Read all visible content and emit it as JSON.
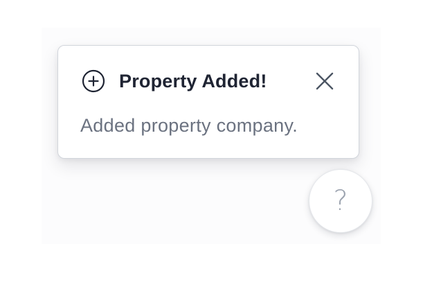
{
  "toast": {
    "icon": "plus-circle-icon",
    "title": "Property Added!",
    "message": "Added property company.",
    "close_icon": "close-icon"
  },
  "help": {
    "icon": "question-icon",
    "glyph": "?"
  },
  "colors": {
    "title": "#1f2433",
    "message": "#6b7280",
    "border": "#d1d5db",
    "help_glyph": "#9ca3af"
  }
}
